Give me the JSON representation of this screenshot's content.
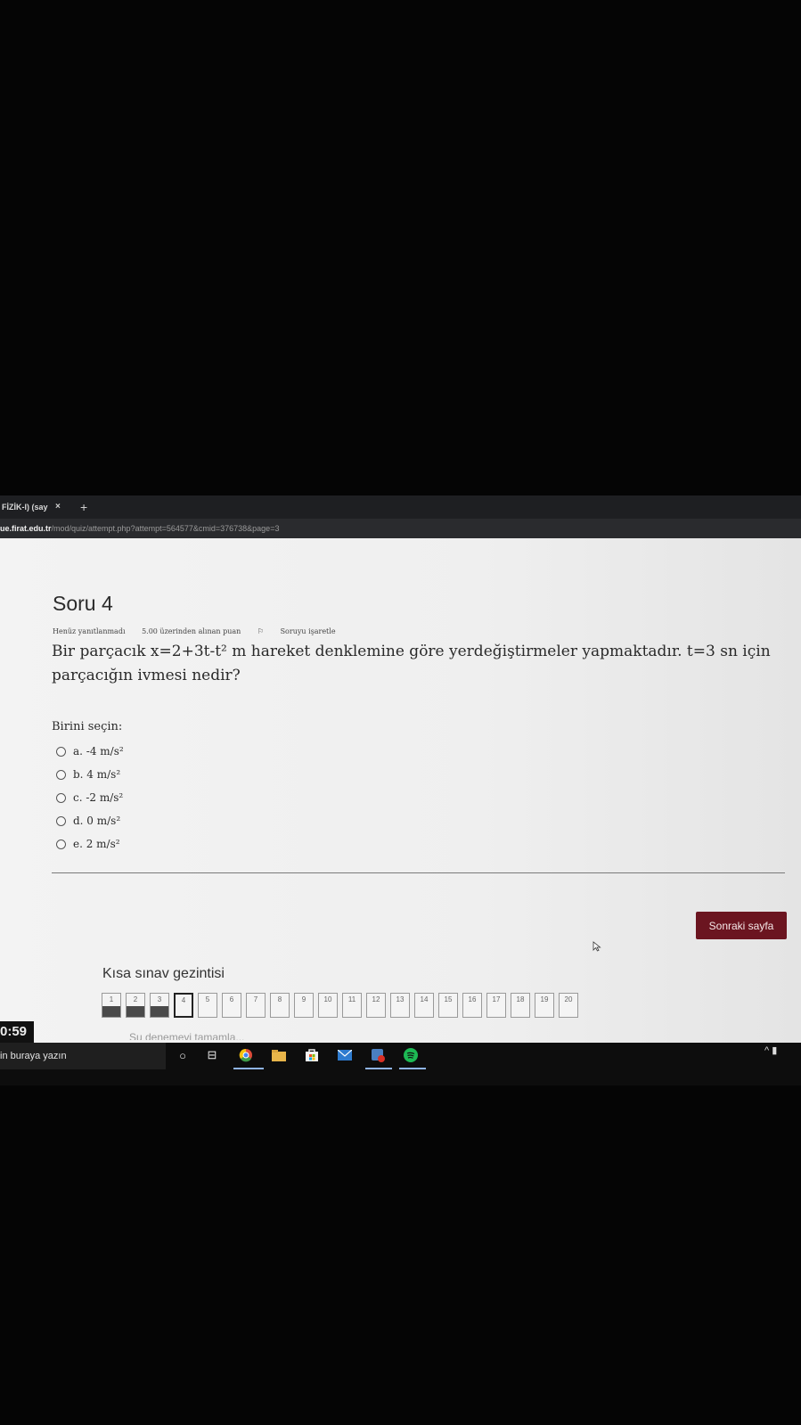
{
  "browser": {
    "tab_label": "FİZİK-I) (say",
    "tab_close": "×",
    "new_tab": "+",
    "url_domain": "ue.firat.edu.tr",
    "url_path": "/mod/quiz/attempt.php?attempt=564577&cmid=376738&page=3"
  },
  "question": {
    "title": "Soru 4",
    "status": "Henüz yanıtlanmadı",
    "points": "5.00 üzerinden alınan puan",
    "flag": "Soruyu işaretle",
    "text": "Bir parçacık x=2+3t-t² m hareket denklemine göre yerdeğiştirmeler yapmaktadır. t=3 sn için parçacığın ivmesi nedir?",
    "prompt": "Birini seçin:",
    "options": [
      "a. -4 m/s²",
      "b. 4 m/s²",
      "c. -2 m/s²",
      "d. 0 m/s²",
      "e. 2 m/s²"
    ]
  },
  "next_button": "Sonraki sayfa",
  "navigation": {
    "title": "Kısa sınav gezintisi",
    "buttons": [
      "1",
      "2",
      "3",
      "4",
      "5",
      "6",
      "7",
      "8",
      "9",
      "10",
      "11",
      "12",
      "13",
      "14",
      "15",
      "16",
      "17",
      "18",
      "19",
      "20"
    ],
    "answered_count": 3,
    "current": "4",
    "footer_partial": "Şu denemeyi tamamla..."
  },
  "taskbar": {
    "timer": "0:59",
    "search_placeholder": "in buraya yazın",
    "icons": [
      "cortana-icon",
      "task-view-icon",
      "chrome-icon",
      "explorer-icon",
      "store-icon",
      "mail-icon",
      "app-icon",
      "spotify-icon"
    ],
    "tray": "^"
  }
}
